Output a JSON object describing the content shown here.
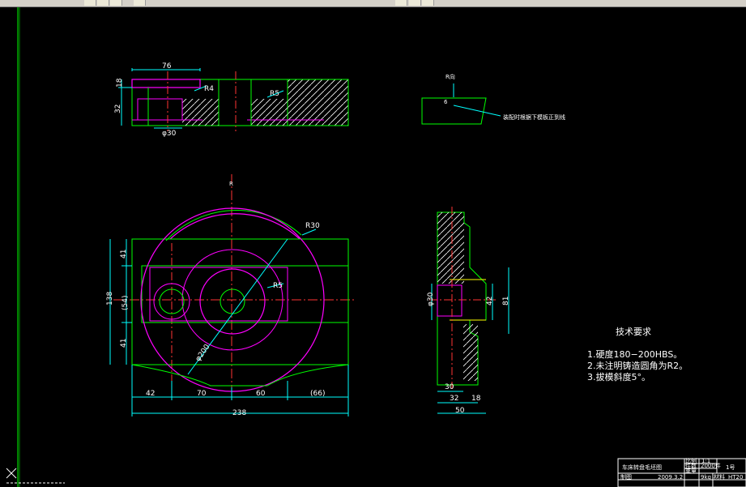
{
  "drawing": {
    "dims": {
      "top_76": "76",
      "top_18": "18",
      "top_32": "32",
      "top_phi30": "φ30",
      "top_R4": "R4",
      "top_R5": "R5",
      "r_label_top": "R向",
      "depth_6": "6",
      "note_leader": "装配时根据下模板正到线",
      "r_label_mid": "R",
      "R30": "R30",
      "R5b": "R5",
      "d200": "φ200",
      "h138": "138",
      "h41a": "41",
      "h54": "(54)",
      "h41b": "41",
      "w42": "42",
      "w70": "70",
      "w60": "60",
      "w66": "(66)",
      "w238": "238",
      "side_phi30": "φ30",
      "side_42": "42",
      "side_81": "81",
      "side_30": "30",
      "side_32": "32",
      "side_18": "18",
      "side_50": "50"
    },
    "requirements": {
      "title": "技术要求",
      "item1": "1.硬度180−200HBS。",
      "item2": "2.未注明铸造圆角为R2。",
      "item3": "3.拔模斜度5°。"
    },
    "title_block": {
      "part_name": "车床转盘毛坯图",
      "scale_label": "比例",
      "scale_value": "1:1",
      "count_label": "件数",
      "count_value": "2000件",
      "sheet_value": "1号",
      "weight_label": "重量",
      "weight_value": "9kg",
      "material_label": "材料",
      "material_value": "HT20",
      "draw_label": "制图",
      "date_value": "2009.3.2"
    },
    "colors": {
      "outline": "#00ff00",
      "dimension": "#00ffff",
      "hidden": "#ff00ff",
      "hatch": "#ffffff",
      "center": "#ff3333",
      "text": "#ffffff"
    }
  }
}
